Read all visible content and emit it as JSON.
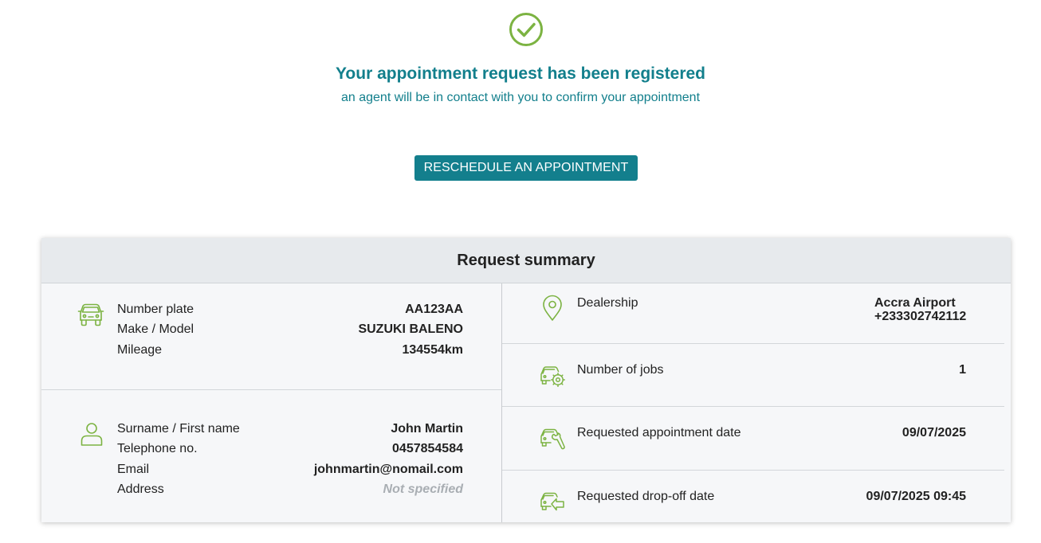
{
  "confirmation": {
    "title": "Your appointment request has been registered",
    "subtitle": "an agent will be in contact with you to confirm your appointment",
    "reschedule_label": "RESCHEDULE AN APPOINTMENT"
  },
  "summary": {
    "title": "Request summary",
    "vehicle": {
      "plate_label": "Number plate",
      "plate_value": "AA123AA",
      "model_label": "Make / Model",
      "model_value": "SUZUKI BALENO",
      "mileage_label": "Mileage",
      "mileage_value": "134554km"
    },
    "customer": {
      "name_label": "Surname / First name",
      "name_value": "John Martin",
      "phone_label": "Telephone no.",
      "phone_value": "0457854584",
      "email_label": "Email",
      "email_value": "johnmartin@nomail.com",
      "address_label": "Address",
      "address_value": "Not specified"
    },
    "dealership": {
      "label": "Dealership",
      "name": "Accra Airport",
      "phone": "+233302742112"
    },
    "jobs": {
      "label": "Number of jobs",
      "value": "1"
    },
    "appointment_date": {
      "label": "Requested appointment date",
      "value": "09/07/2025"
    },
    "dropoff_date": {
      "label": "Requested drop-off date",
      "value": "09/07/2025 09:45"
    }
  },
  "icons": {
    "check": "check-circle-icon",
    "car": "car-icon",
    "person": "person-icon",
    "location": "location-pin-icon",
    "jobs": "car-gear-icon",
    "appointment": "car-wrench-icon",
    "dropoff": "car-key-icon"
  },
  "colors": {
    "accent": "#127f8c",
    "icon_green": "#7cb342",
    "muted": "#a9aeb3"
  }
}
